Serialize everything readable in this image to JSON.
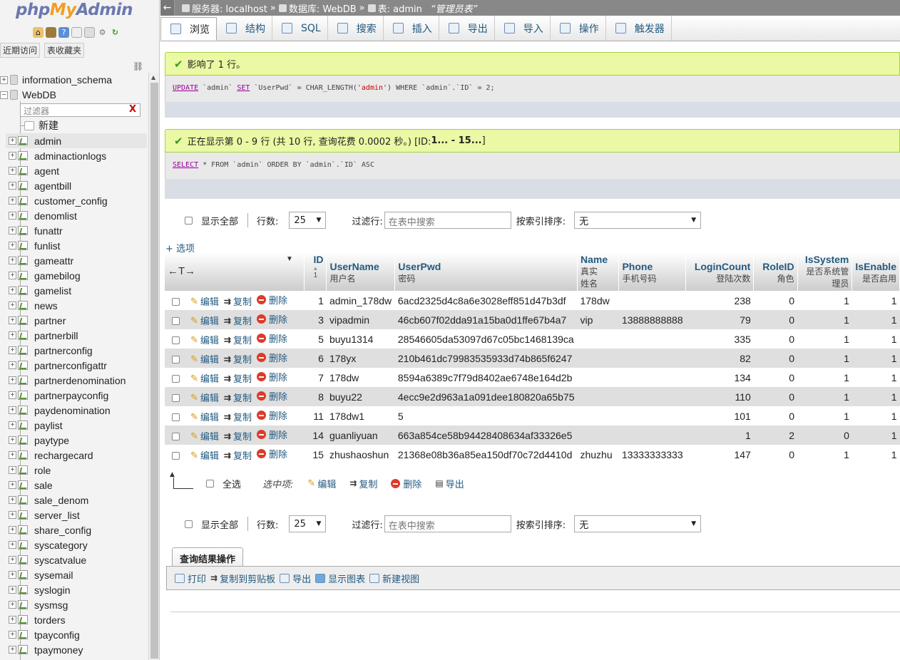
{
  "nav": {
    "logo": {
      "php": "php",
      "my": "My",
      "admin": "Admin"
    },
    "tabs": [
      "近期访问",
      "表收藏夹"
    ],
    "databases": [
      "information_schema",
      "WebDB"
    ],
    "filter_placeholder": "过滤器",
    "filter_clear": "X",
    "new_label": "新建",
    "tables": [
      "admin",
      "adminactionlogs",
      "agent",
      "agentbill",
      "customer_config",
      "denomlist",
      "funattr",
      "funlist",
      "gameattr",
      "gamebilog",
      "gamelist",
      "news",
      "partner",
      "partnerbill",
      "partnerconfig",
      "partnerconfigattr",
      "partnerdenomination",
      "partnerpayconfig",
      "paydenomination",
      "paylist",
      "paytype",
      "rechargecard",
      "role",
      "sale",
      "sale_denom",
      "server_list",
      "share_config",
      "syscategory",
      "syscatvalue",
      "sysemail",
      "syslogin",
      "sysmsg",
      "torders",
      "tpayconfig",
      "tpaymoney"
    ]
  },
  "breadcrumb": {
    "back": "←",
    "server": "服务器: localhost",
    "db": "数据库: WebDB",
    "table": "表: admin",
    "comment": "“管理员表”",
    "sep": "»"
  },
  "tabs": [
    "浏览",
    "结构",
    "SQL",
    "搜索",
    "插入",
    "导出",
    "导入",
    "操作",
    "触发器"
  ],
  "messages": {
    "affected": "影响了 1 行。",
    "update_sql": {
      "kw1": "UPDATE",
      "p1": " `admin` ",
      "kw2": "SET",
      "p2": " `UserPwd` = CHAR_LENGTH(",
      "str": "'admin'",
      "p3": ") WHERE `admin`.`ID` = 2;"
    },
    "showing": "正在显示第 0 - 9 行 (共 10 行, 查询花费 0.0002 秒。) [ID: ",
    "showing_range": "1... - 15...",
    "showing_end": "]",
    "select_sql": {
      "kw": "SELECT",
      "rest": " * FROM `admin` ORDER BY `admin`.`ID` ASC"
    }
  },
  "controls": {
    "show_all": "显示全部",
    "rows_label": "行数:",
    "rows_value": "25",
    "filter_label": "过滤行:",
    "filter_placeholder": "在表中搜索",
    "sort_label": "按索引排序:",
    "sort_value": "无",
    "options": "+ 选项"
  },
  "table": {
    "headers": [
      {
        "name": "ID",
        "sub": ""
      },
      {
        "name": "UserName",
        "sub": "用户名"
      },
      {
        "name": "UserPwd",
        "sub": "密码"
      },
      {
        "name": "Name",
        "sub": "真实姓名"
      },
      {
        "name": "Phone",
        "sub": "手机号码"
      },
      {
        "name": "LoginCount",
        "sub": "登陆次数"
      },
      {
        "name": "RoleID",
        "sub": "角色"
      },
      {
        "name": "IsSystem",
        "sub": "是否系统管理员"
      },
      {
        "name": "IsEnable",
        "sub": "是否启用"
      }
    ],
    "sort_order_mark": "1",
    "actions": {
      "edit": "编辑",
      "copy": "复制",
      "delete": "删除"
    },
    "rows": [
      {
        "id": "1",
        "username": "admin_178dw",
        "pwd": "6acd2325d4c8a6e3028eff851d47b3df",
        "name": "178dw",
        "phone": "",
        "login": "238",
        "role": "0",
        "issys": "1",
        "enable": "1"
      },
      {
        "id": "3",
        "username": "vipadmin",
        "pwd": "46cb607f02dda91a15ba0d1ffe67b4a7",
        "name": "vip",
        "phone": "13888888888",
        "login": "79",
        "role": "0",
        "issys": "1",
        "enable": "1"
      },
      {
        "id": "5",
        "username": "buyu1314",
        "pwd": "28546605da53097d67c05bc1468139ca",
        "name": "",
        "phone": "",
        "login": "335",
        "role": "0",
        "issys": "1",
        "enable": "1"
      },
      {
        "id": "6",
        "username": "178yx",
        "pwd": "210b461dc79983535933d74b865f6247",
        "name": "",
        "phone": "",
        "login": "82",
        "role": "0",
        "issys": "1",
        "enable": "1"
      },
      {
        "id": "7",
        "username": "178dw",
        "pwd": "8594a6389c7f79d8402ae6748e164d2b",
        "name": "",
        "phone": "",
        "login": "134",
        "role": "0",
        "issys": "1",
        "enable": "1"
      },
      {
        "id": "8",
        "username": "buyu22",
        "pwd": "4ecc9e2d963a1a091dee180820a65b75",
        "name": "",
        "phone": "",
        "login": "110",
        "role": "0",
        "issys": "1",
        "enable": "1"
      },
      {
        "id": "11",
        "username": "178dw1",
        "pwd": "5",
        "name": "",
        "phone": "",
        "login": "101",
        "role": "0",
        "issys": "1",
        "enable": "1"
      },
      {
        "id": "14",
        "username": "guanliyuan",
        "pwd": "663a854ce58b94428408634af33326e5",
        "name": "",
        "phone": "",
        "login": "1",
        "role": "2",
        "issys": "0",
        "enable": "1"
      },
      {
        "id": "15",
        "username": "zhushaoshun",
        "pwd": "21368e08b36a85ea150df70c72d4410d",
        "name": "zhuzhu",
        "phone": "13333333333",
        "login": "147",
        "role": "0",
        "issys": "1",
        "enable": "1"
      }
    ]
  },
  "bulk": {
    "select_all": "全选",
    "with_selected": "选中项:",
    "edit": "编辑",
    "copy": "复制",
    "delete": "删除",
    "export": "导出"
  },
  "query_ops": {
    "title": "查询结果操作",
    "items": [
      "打印",
      "复制到剪贴板",
      "导出",
      "显示图表",
      "新建视图"
    ]
  }
}
